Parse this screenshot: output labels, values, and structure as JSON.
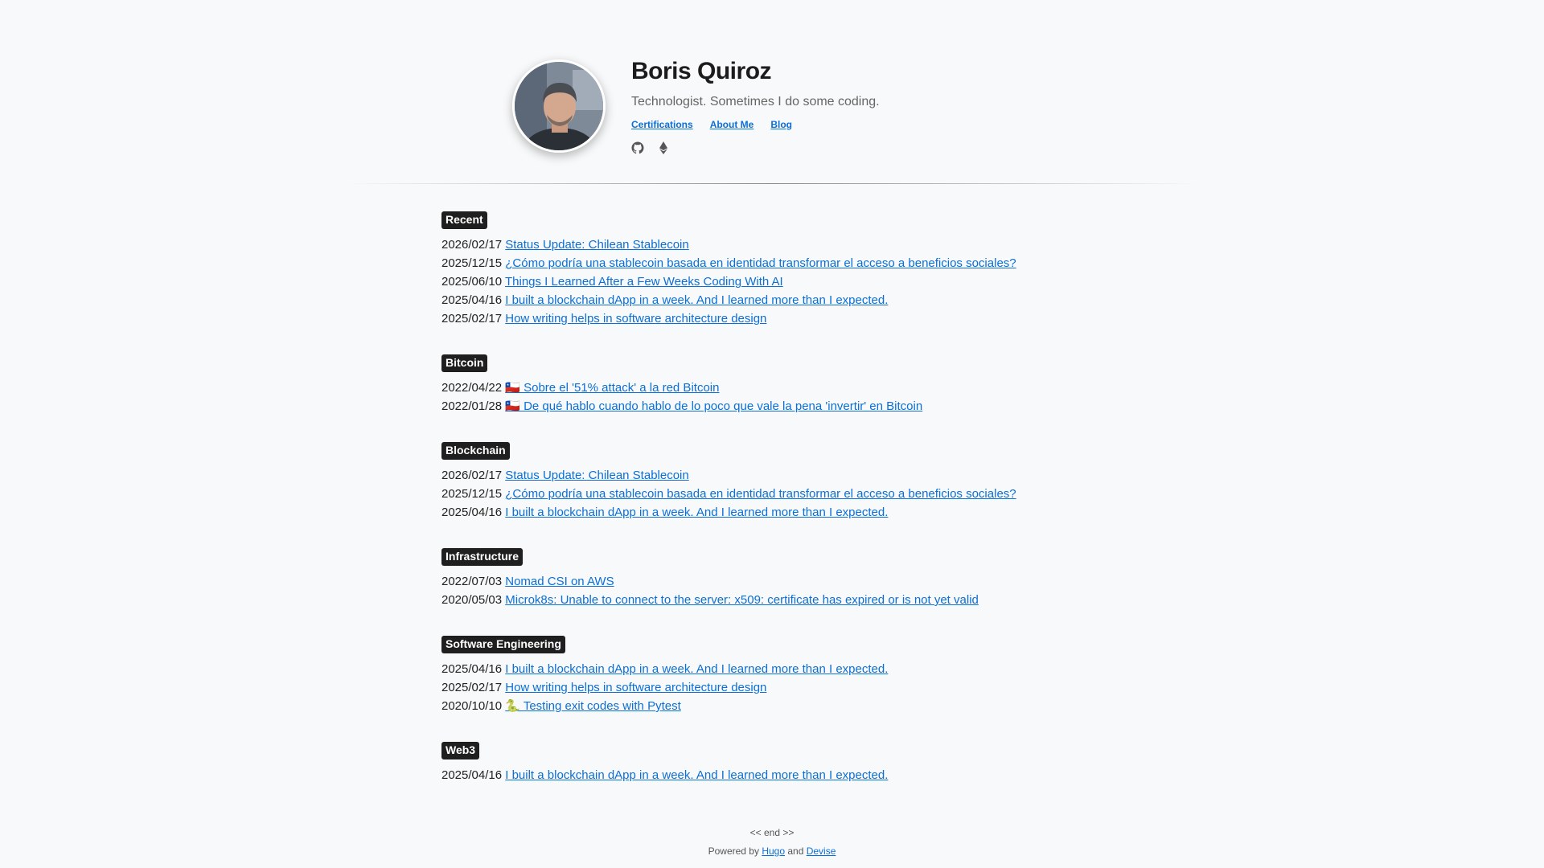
{
  "profile": {
    "name": "Boris Quiroz",
    "tagline": "Technologist. Sometimes I do some coding.",
    "nav": [
      {
        "label": "Certifications"
      },
      {
        "label": "About Me"
      },
      {
        "label": "Blog"
      }
    ],
    "socials": [
      "github-icon",
      "ethereum-icon"
    ]
  },
  "sections": [
    {
      "tag": "Recent",
      "posts": [
        {
          "date": "2026/02/17",
          "title": "Status Update: Chilean Stablecoin"
        },
        {
          "date": "2025/12/15",
          "title": "¿Cómo podría una stablecoin basada en identidad transformar el acceso a beneficios sociales?"
        },
        {
          "date": "2025/06/10",
          "title": "Things I Learned After a Few Weeks Coding With AI"
        },
        {
          "date": "2025/04/16",
          "title": "I built a blockchain dApp in a week. And I learned more than I expected."
        },
        {
          "date": "2025/02/17",
          "title": "How writing helps in software architecture design"
        }
      ]
    },
    {
      "tag": "Bitcoin",
      "posts": [
        {
          "date": "2022/04/22",
          "title": "🇨🇱 Sobre el '51% attack' a la red Bitcoin"
        },
        {
          "date": "2022/01/28",
          "title": "🇨🇱 De qué hablo cuando hablo de lo poco que vale la pena 'invertir' en Bitcoin"
        }
      ]
    },
    {
      "tag": "Blockchain",
      "posts": [
        {
          "date": "2026/02/17",
          "title": "Status Update: Chilean Stablecoin"
        },
        {
          "date": "2025/12/15",
          "title": "¿Cómo podría una stablecoin basada en identidad transformar el acceso a beneficios sociales?"
        },
        {
          "date": "2025/04/16",
          "title": "I built a blockchain dApp in a week. And I learned more than I expected."
        }
      ]
    },
    {
      "tag": "Infrastructure",
      "posts": [
        {
          "date": "2022/07/03",
          "title": "Nomad CSI on AWS"
        },
        {
          "date": "2020/05/03",
          "title": "Microk8s: Unable to connect to the server: x509: certificate has expired or is not yet valid"
        }
      ]
    },
    {
      "tag": "Software Engineering",
      "posts": [
        {
          "date": "2025/04/16",
          "title": "I built a blockchain dApp in a week. And I learned more than I expected."
        },
        {
          "date": "2025/02/17",
          "title": "How writing helps in software architecture design"
        },
        {
          "date": "2020/10/10",
          "title": "🐍 Testing exit codes with Pytest"
        }
      ]
    },
    {
      "tag": "Web3",
      "posts": [
        {
          "date": "2025/04/16",
          "title": "I built a blockchain dApp in a week. And I learned more than I expected."
        }
      ]
    }
  ],
  "footer": {
    "end_text": "<< end >>",
    "powered_prefix": "Powered by",
    "hugo_label": "Hugo",
    "and_text": "and",
    "devise_label": "Devise"
  },
  "colors": {
    "background": "#f8f9fa",
    "link": "#0b6fd6",
    "tag_bg": "#1f1f1f"
  }
}
